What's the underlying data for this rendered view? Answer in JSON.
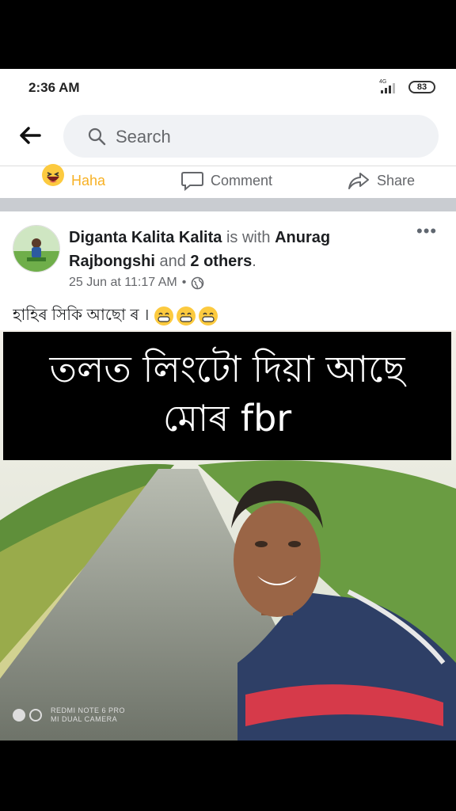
{
  "status": {
    "time": "2:36 AM",
    "network": "4G",
    "battery": "83"
  },
  "search": {
    "placeholder": "Search"
  },
  "actions": {
    "haha": "Haha",
    "comment": "Comment",
    "share": "Share"
  },
  "post": {
    "author": "Diganta Kalita Kalita",
    "with_text": "is with",
    "tagged": "Anurag Rajbongshi",
    "tagged_line1": "Anurag",
    "tagged_line2": "Rajbongshi",
    "and_text": "and",
    "others": "2 others",
    "date": "25 Jun at 11:17 AM",
    "text": "হাহিৰ সিকি আছো ৰ ।",
    "more": "•••"
  },
  "overlay": {
    "line1": "তলত লিংটো দিয়া আছে",
    "line2": "মোৰ fbr"
  },
  "watermark": {
    "line1": "REDMI NOTE 6 PRO",
    "line2": "MI DUAL CAMERA"
  }
}
